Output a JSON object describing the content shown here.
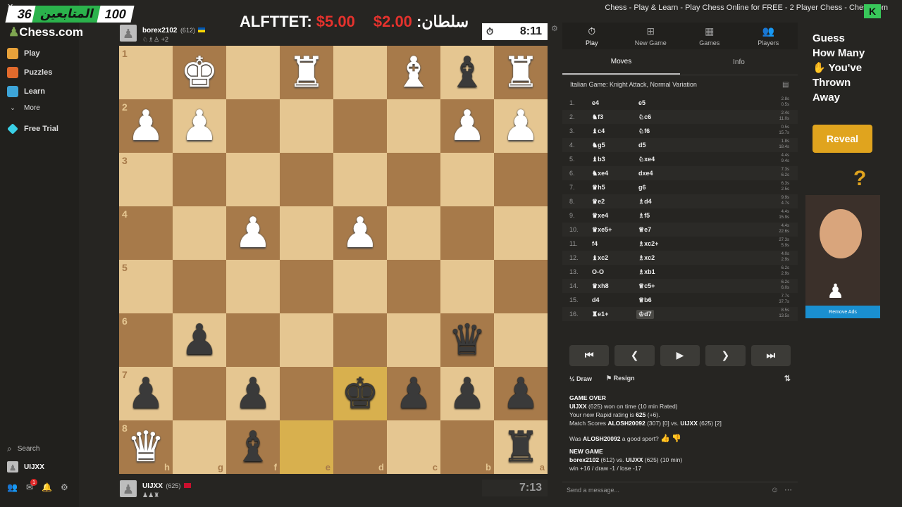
{
  "overlay": {
    "left_count": "36",
    "followers_label": "المتابعين",
    "right_count": "100",
    "close_glyph": "✕"
  },
  "match": {
    "left_name": "ALFTTET:",
    "left_amount": "$5.00",
    "right_amount": "2.00$",
    "right_name": "سلطان:"
  },
  "window_title": "Chess - Play & Learn - Play Chess Online for FREE - 2 Player Chess - Chess.com",
  "sidebar": {
    "logo": "Chess.com",
    "items": [
      {
        "label": "Play",
        "icon": "play-icon",
        "color": "#e8a23a"
      },
      {
        "label": "Puzzles",
        "icon": "puzzle-icon",
        "color": "#e26a2c"
      },
      {
        "label": "Learn",
        "icon": "learn-icon",
        "color": "#3da5d9"
      },
      {
        "label": "More",
        "icon": "chevron-down-icon",
        "color": "#888"
      },
      {
        "label": "Free Trial",
        "icon": "diamond-icon",
        "color": "#3ad0e6"
      }
    ],
    "search": "Search",
    "user": "UIJXX",
    "notif_count": "1"
  },
  "top_player": {
    "name": "borex2102",
    "rating": "(612)",
    "extra": "+2",
    "clock": "8:11"
  },
  "bottom_player": {
    "name": "UIJXX",
    "rating": "(625)",
    "clock": "7:13"
  },
  "board": {
    "rows": [
      {
        "rank": "1",
        "cells": [
          "",
          "wK",
          "",
          "wR",
          "",
          "wB",
          "bB",
          "wR"
        ]
      },
      {
        "rank": "2",
        "cells": [
          "wP",
          "wP",
          "",
          "",
          "",
          "",
          "wP",
          "wP"
        ]
      },
      {
        "rank": "3",
        "cells": [
          "",
          "",
          "",
          "",
          "",
          "",
          "",
          ""
        ]
      },
      {
        "rank": "4",
        "cells": [
          "",
          "",
          "wP",
          "",
          "wP",
          "",
          "",
          ""
        ]
      },
      {
        "rank": "5",
        "cells": [
          "",
          "",
          "",
          "",
          "",
          "",
          "",
          ""
        ]
      },
      {
        "rank": "6",
        "cells": [
          "",
          "bP",
          "",
          "",
          "",
          "",
          "bQ",
          ""
        ]
      },
      {
        "rank": "7",
        "cells": [
          "bP",
          "",
          "bP",
          "",
          "bK",
          "bP",
          "bP",
          "bP"
        ]
      },
      {
        "rank": "8",
        "cells": [
          "wQ",
          "",
          "bB",
          "",
          "",
          "",
          "",
          "bR"
        ]
      }
    ],
    "files": [
      "h",
      "g",
      "f",
      "e",
      "d",
      "c",
      "b",
      "a"
    ],
    "highlight": [
      [
        6,
        4
      ],
      [
        7,
        3
      ]
    ]
  },
  "panel": {
    "tabs": [
      {
        "label": "Play",
        "icon": "stopwatch-icon"
      },
      {
        "label": "New Game",
        "icon": "plus-icon"
      },
      {
        "label": "Games",
        "icon": "grid-icon"
      },
      {
        "label": "Players",
        "icon": "players-icon"
      }
    ],
    "subtabs": [
      "Moves",
      "Info"
    ],
    "opening": "Italian Game: Knight Attack, Normal Variation",
    "moves": [
      {
        "n": "1.",
        "w": "e4",
        "b": "e5",
        "t1": "2.8s",
        "t2": "0.5s"
      },
      {
        "n": "2.",
        "w": "♞f3",
        "b": "♘c6",
        "t1": "2.4s",
        "t2": "11.0s"
      },
      {
        "n": "3.",
        "w": "♝c4",
        "b": "♘f6",
        "t1": "0.5s",
        "t2": "15.7s"
      },
      {
        "n": "4.",
        "w": "♞g5",
        "b": "d5",
        "t1": "1.8s",
        "t2": "18.4s"
      },
      {
        "n": "5.",
        "w": "♝b3",
        "b": "♘xe4",
        "t1": "4.4s",
        "t2": "9.4s"
      },
      {
        "n": "6.",
        "w": "♞xe4",
        "b": "dxe4",
        "t1": "7.3s",
        "t2": "6.2s"
      },
      {
        "n": "7.",
        "w": "♛h5",
        "b": "g6",
        "t1": "6.3s",
        "t2": "2.5s"
      },
      {
        "n": "8.",
        "w": "♛e2",
        "b": "♗d4",
        "t1": "9.9s",
        "t2": "4.7s"
      },
      {
        "n": "9.",
        "w": "♛xe4",
        "b": "♗f5",
        "t1": "4.4s",
        "t2": "15.9s"
      },
      {
        "n": "10.",
        "w": "♛xe5+",
        "b": "♕e7",
        "t1": "4.4s",
        "t2": "22.6s"
      },
      {
        "n": "11.",
        "w": "f4",
        "b": "♗xc2+",
        "t1": "27.3s",
        "t2": "5.9s"
      },
      {
        "n": "12.",
        "w": "♝xc2",
        "b": "♗xc2",
        "t1": "4.0s",
        "t2": "2.9s"
      },
      {
        "n": "13.",
        "w": "O-O",
        "b": "♗xb1",
        "t1": "6.2s",
        "t2": "2.9s"
      },
      {
        "n": "14.",
        "w": "♛xh8",
        "b": "♕c5+",
        "t1": "6.2s",
        "t2": "6.0s"
      },
      {
        "n": "15.",
        "w": "d4",
        "b": "♕b6",
        "t1": "7.7s",
        "t2": "37.7s"
      },
      {
        "n": "16.",
        "w": "♜e1+",
        "b": "♔d7",
        "t1": "8.5s",
        "t2": "13.5s"
      }
    ],
    "controls": [
      "⏮",
      "❮",
      "▶",
      "❯",
      "⏭"
    ],
    "draw": "Draw",
    "resign": "Resign",
    "log": {
      "game_over": "GAME OVER",
      "winner": "UIJXX",
      "won_text": " (625) won on time (10 min Rated)",
      "rating_text": "Your new Rapid rating is ",
      "rating_value": "625",
      "rating_delta": " (+6).",
      "match_text": "Match Scores ",
      "p1": "ALOSH20092",
      "p1_score": " (307) [0] vs. ",
      "p2": "UIJXX",
      "p2_score": " (625) [2]",
      "sport_q1": "Was ",
      "sport_name": "ALOSH20092",
      "sport_q2": " a good sport?",
      "new_game": "NEW GAME",
      "ng_p1": "borex2102",
      "ng_mid": " (612) vs. ",
      "ng_p2": "UIJXX",
      "ng_end": " (625) (10 min)",
      "stakes": "win +16 / draw -1 / lose -17"
    },
    "message_placeholder": "Send a message..."
  },
  "ad": {
    "line1": "Guess",
    "line2": "How Many",
    "line3": "You've",
    "line4": "Thrown",
    "line5": "Away",
    "button": "Reveal",
    "remove": "Remove Ads"
  }
}
